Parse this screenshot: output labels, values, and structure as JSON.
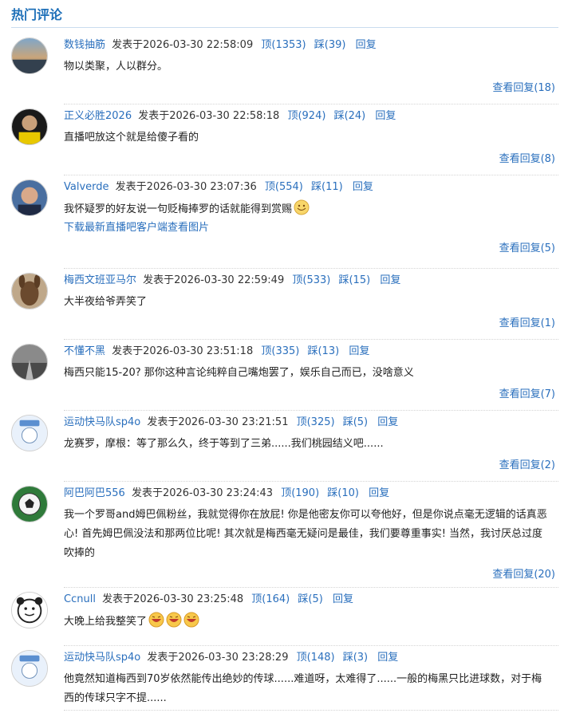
{
  "header": {
    "title": "热门评论"
  },
  "comments": [
    {
      "user": "数钱抽筋",
      "time": "发表于2026-03-30 22:58:09",
      "up": "顶(1353)",
      "down": "踩(39)",
      "reply": "回复",
      "text": "物以类聚，人以群分。",
      "more": "查看回复(18)"
    },
    {
      "user": "正义必胜2026",
      "time": "发表于2026-03-30 22:58:18",
      "up": "顶(924)",
      "down": "踩(24)",
      "reply": "回复",
      "text": "直播吧放这个就是给傻子看的",
      "more": "查看回复(8)"
    },
    {
      "user": "Valverde",
      "time": "发表于2026-03-30 23:07:36",
      "up": "顶(554)",
      "down": "踩(11)",
      "reply": "回复",
      "text": "我怀疑罗的好友说一句贬梅捧罗的话就能得到赏赐",
      "link": "下载最新直播吧客户端查看图片",
      "more": "查看回复(5)"
    },
    {
      "user": "梅西文班亚马尔",
      "time": "发表于2026-03-30 22:59:49",
      "up": "顶(533)",
      "down": "踩(15)",
      "reply": "回复",
      "text": "大半夜给爷弄笑了",
      "more": "查看回复(1)"
    },
    {
      "user": "不懂不黑",
      "time": "发表于2026-03-30 23:51:18",
      "up": "顶(335)",
      "down": "踩(13)",
      "reply": "回复",
      "text": "梅西只能15-20? 那你这种言论纯粹自己嘴炮罢了，娱乐自己而已，没啥意义",
      "more": "查看回复(7)"
    },
    {
      "user": "运动快马队sp4o",
      "time": "发表于2026-03-30 23:21:51",
      "up": "顶(325)",
      "down": "踩(5)",
      "reply": "回复",
      "text": "龙赛罗，摩根：等了那么久，终于等到了三弟......我们桃园结义吧......",
      "more": "查看回复(2)"
    },
    {
      "user": "阿巴阿巴556",
      "time": "发表于2026-03-30 23:24:43",
      "up": "顶(190)",
      "down": "踩(10)",
      "reply": "回复",
      "text": "我一个罗哥and姆巴佩粉丝，我就觉得你在放屁! 你是他密友你可以夸他好，但是你说点毫无逻辑的话真恶心! 首先姆巴佩没法和那两位比呢! 其次就是梅西毫无疑问是最佳，我们要尊重事实! 当然，我讨厌总过度吹捧的",
      "more": "查看回复(20)"
    },
    {
      "user": "Ccnull",
      "time": "发表于2026-03-30 23:25:48",
      "up": "顶(164)",
      "down": "踩(5)",
      "reply": "回复",
      "text": "大晚上给我整笑了"
    },
    {
      "user": "运动快马队sp4o",
      "time": "发表于2026-03-30 23:28:29",
      "up": "顶(148)",
      "down": "踩(3)",
      "reply": "回复",
      "text": "他竟然知道梅西到70岁依然能传出绝妙的传球......难道呀，太难得了......一般的梅黑只比进球数，对于梅西的传球只字不提......"
    }
  ]
}
